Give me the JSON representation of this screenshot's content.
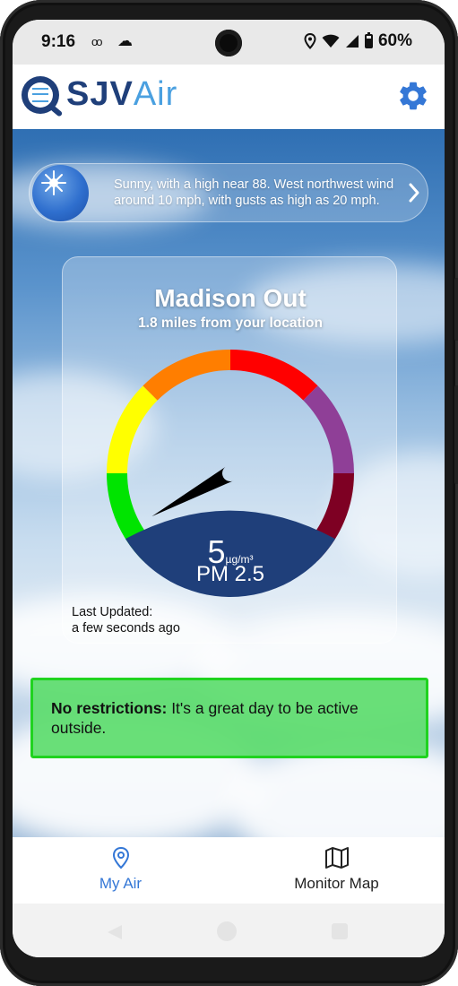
{
  "status_bar": {
    "time": "9:16",
    "battery_percent": "60%",
    "icons": [
      "voicemail-icon",
      "cloud-icon",
      "location-icon",
      "wifi-icon",
      "cell-signal-icon",
      "battery-icon"
    ]
  },
  "header": {
    "logo_primary": "SJV",
    "logo_secondary": "Air",
    "settings_icon": "gear-icon",
    "brand_color": "#1f3f7a",
    "accent_color": "#4aa0e0"
  },
  "forecast": {
    "text": "Sunny, with a high near 88. West northwest wind around 10 mph, with gusts as high as 20 mph.",
    "icon": "sun-icon",
    "action_icon": "chevron-right-icon"
  },
  "monitor": {
    "name": "Madison Out",
    "distance": "1.8 miles from your location",
    "value": "5",
    "unit": "µg/m³",
    "parameter": "PM 2.5",
    "last_updated_label": "Last Updated:",
    "last_updated_value": "a few seconds ago",
    "gauge_segments": [
      {
        "color": "#00e400"
      },
      {
        "color": "#ffff00"
      },
      {
        "color": "#ff7e00"
      },
      {
        "color": "#ff0000"
      },
      {
        "color": "#8f3f97"
      },
      {
        "color": "#7e0023"
      }
    ],
    "needle_fraction": 0.06
  },
  "banner": {
    "bold": "No restrictions:",
    "text": " It's a great day to be active outside.",
    "color": "#1fd31f"
  },
  "bottom_nav": {
    "items": [
      {
        "label": "My Air",
        "icon": "location-pin-icon",
        "active": true
      },
      {
        "label": "Monitor Map",
        "icon": "map-icon",
        "active": false
      }
    ],
    "active_color": "#3477d6"
  }
}
